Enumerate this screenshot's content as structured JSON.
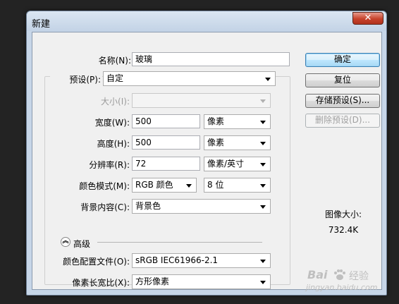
{
  "window": {
    "title": "新建",
    "close_glyph": "✕"
  },
  "form": {
    "name": {
      "label": "名称(N):",
      "value": "玻璃"
    },
    "preset": {
      "label": "预设(P):",
      "value": "自定"
    },
    "size": {
      "label": "大小(I):",
      "value": ""
    },
    "width": {
      "label": "宽度(W):",
      "value": "500",
      "unit": "像素"
    },
    "height": {
      "label": "高度(H):",
      "value": "500",
      "unit": "像素"
    },
    "resolution": {
      "label": "分辨率(R):",
      "value": "72",
      "unit": "像素/英寸"
    },
    "color_mode": {
      "label": "颜色模式(M):",
      "value": "RGB 颜色",
      "depth": "8 位"
    },
    "background": {
      "label": "背景内容(C):",
      "value": "背景色"
    },
    "advanced": {
      "label": "高级"
    },
    "color_profile": {
      "label": "颜色配置文件(O):",
      "value": "sRGB IEC61966-2.1"
    },
    "pixel_aspect": {
      "label": "像素长宽比(X):",
      "value": "方形像素"
    }
  },
  "buttons": {
    "ok": "确定",
    "reset": "复位",
    "save_preset": "存储预设(S)...",
    "delete_preset": "删除预设(D)..."
  },
  "image_size": {
    "label": "图像大小:",
    "value": "732.4K"
  },
  "watermark": {
    "brand": "Bai",
    "brand2": "经验",
    "url": "jingyan.baidu.com"
  }
}
